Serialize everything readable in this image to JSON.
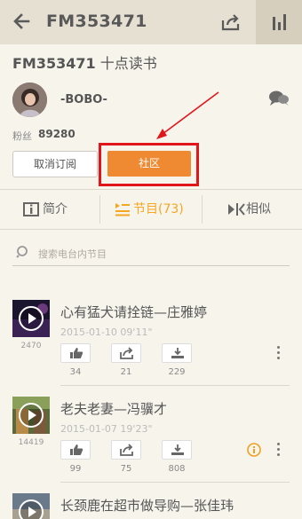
{
  "topbar": {
    "title": "FM353471"
  },
  "station": {
    "code": "FM353471",
    "name": "十点读书"
  },
  "owner": {
    "name": "-BOBO-"
  },
  "fans": {
    "label": "粉丝",
    "count": "89280"
  },
  "buttons": {
    "unsubscribe": "取消订阅",
    "community": "社区"
  },
  "tabs": {
    "intro": "简介",
    "programs": "节目(73)",
    "similar": "相似"
  },
  "search": {
    "placeholder": "搜索电台内节目"
  },
  "programs": [
    {
      "title": "心有猛犬请拴链—庄雅婷",
      "date": "2015-01-10  09'11\"",
      "plays": "2470",
      "likes": "34",
      "shares": "21",
      "downloads": "229"
    },
    {
      "title": "老夫老妻—冯骥才",
      "date": "2015-01-07  19'23\"",
      "plays": "14419",
      "likes": "99",
      "shares": "75",
      "downloads": "808"
    },
    {
      "title": "长颈鹿在超市做导购—张佳玮"
    }
  ],
  "colors": {
    "accent": "#f08a32",
    "highlight": "#e0161b",
    "active_tab": "#f5a623"
  }
}
